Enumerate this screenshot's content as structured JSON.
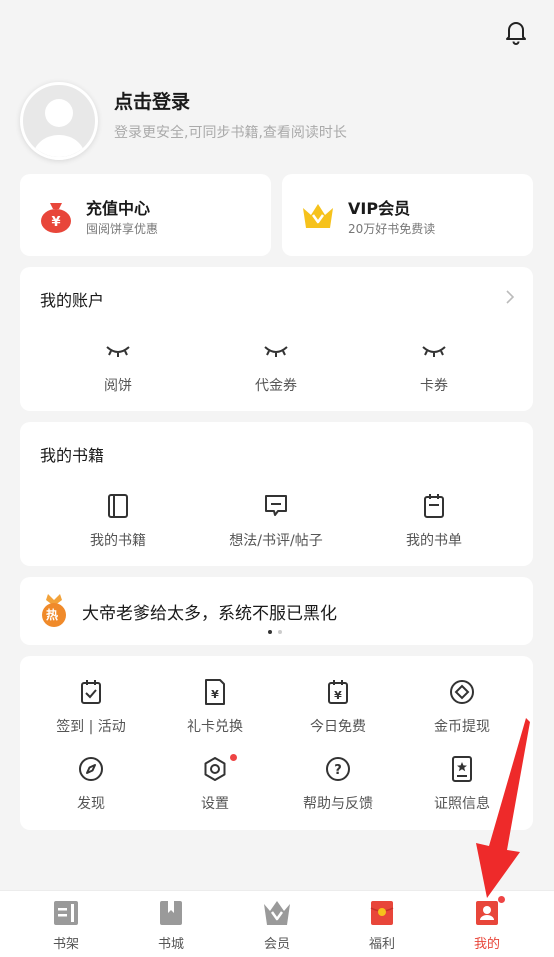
{
  "header": {
    "bell_icon": "bell-icon"
  },
  "profile": {
    "title": "点击登录",
    "subtitle": "登录更安全,可同步书籍,查看阅读时长"
  },
  "promos": [
    {
      "title": "充值中心",
      "subtitle": "囤阅饼享优惠",
      "icon": "money-bag-icon",
      "color": "#e8463a"
    },
    {
      "title": "VIP会员",
      "subtitle": "20万好书免费读",
      "icon": "crown-icon",
      "color": "#f6c21c"
    }
  ],
  "account": {
    "title": "我的账户",
    "items": [
      {
        "label": "阅饼"
      },
      {
        "label": "代金券"
      },
      {
        "label": "卡券"
      }
    ]
  },
  "books": {
    "title": "我的书籍",
    "items": [
      {
        "label": "我的书籍"
      },
      {
        "label": "想法/书评/帖子"
      },
      {
        "label": "我的书单"
      }
    ]
  },
  "hot": {
    "badge": "热",
    "text": "大帝老爹给太多，系统不服已黑化"
  },
  "tools": [
    {
      "label": "签到 | 活动"
    },
    {
      "label": "礼卡兑换"
    },
    {
      "label": "今日免费"
    },
    {
      "label": "金币提现"
    },
    {
      "label": "发现"
    },
    {
      "label": "设置"
    },
    {
      "label": "帮助与反馈"
    },
    {
      "label": "证照信息"
    }
  ],
  "tabbar": {
    "tabs": [
      {
        "label": "书架"
      },
      {
        "label": "书城"
      },
      {
        "label": "会员"
      },
      {
        "label": "福利"
      },
      {
        "label": "我的"
      }
    ],
    "active_color": "#e8463a"
  }
}
